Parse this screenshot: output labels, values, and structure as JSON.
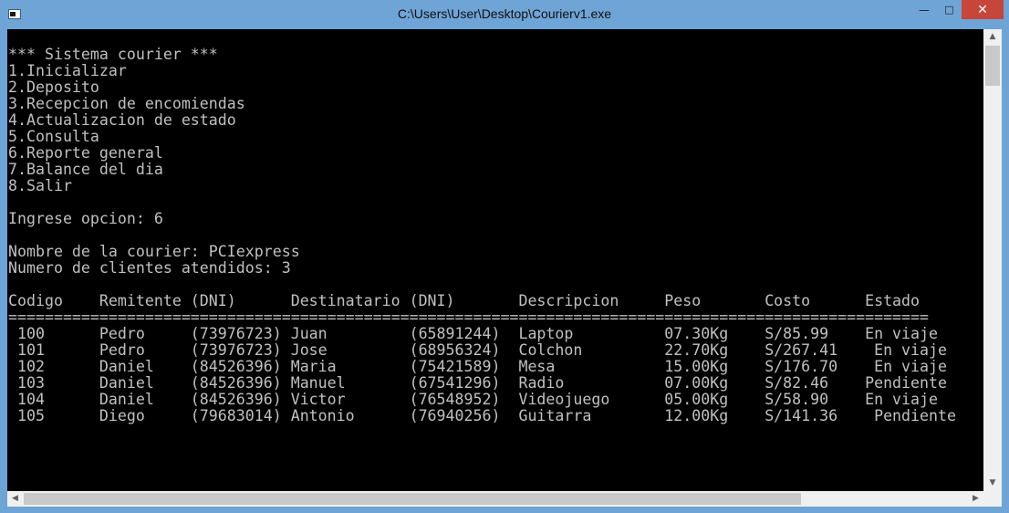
{
  "window": {
    "title": "C:\\Users\\User\\Desktop\\Courierv1.exe",
    "controls": {
      "minimize": "—",
      "maximize": "□",
      "close": "✕"
    }
  },
  "console": {
    "lines": [
      "*** Sistema courier ***",
      "1.Inicializar",
      "2.Deposito",
      "3.Recepcion de encomiendas",
      "4.Actualizacion de estado",
      "5.Consulta",
      "6.Reporte general",
      "7.Balance del dia",
      "8.Salir",
      "",
      "Ingrese opcion: 6",
      "",
      "Nombre de la courier: PCIexpress",
      "Numero de clientes atendidos: 3",
      "",
      "Codigo    Remitente (DNI)      Destinatario (DNI)       Descripcion     Peso       Costo      Estado",
      "=====================================================================================================",
      " 100      Pedro     (73976723) Juan         (65891244)  Laptop          07.30Kg    S/85.99    En viaje",
      " 101      Pedro     (73976723) Jose         (68956324)  Colchon         22.70Kg    S/267.41    En viaje",
      " 102      Daniel    (84526396) Maria        (75421589)  Mesa            15.00Kg    S/176.70    En viaje",
      " 103      Daniel    (84526396) Manuel       (67541296)  Radio           07.00Kg    S/82.46    Pendiente",
      " 104      Daniel    (84526396) Victor       (76548952)  Videojuego      05.00Kg    S/58.90    En viaje",
      " 105      Diego     (79683014) Antonio      (76940256)  Guitarra        12.00Kg    S/141.36    Pendiente"
    ]
  },
  "scrollbars": {
    "up_arrow": "▲",
    "down_arrow": "▼",
    "left_arrow": "◀",
    "right_arrow": "▶"
  }
}
